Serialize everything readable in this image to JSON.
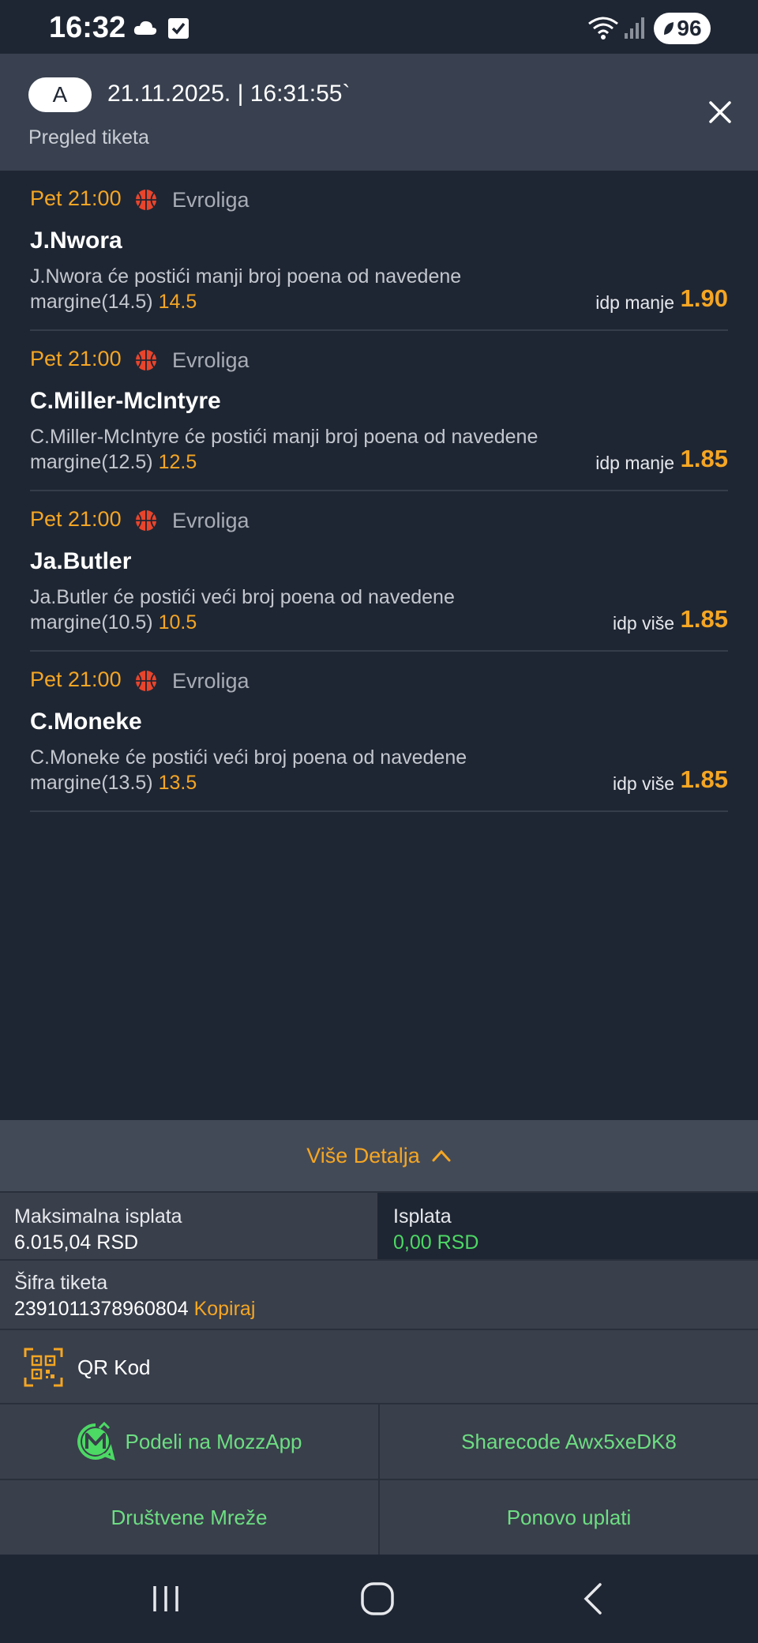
{
  "status_bar": {
    "time": "16:32",
    "battery": "96",
    "icons": [
      "cloud-icon",
      "check-icon",
      "wifi-icon",
      "signal-icon",
      "battery-icon"
    ]
  },
  "header": {
    "avatar": "A",
    "datetime": "21.11.2025. | 16:31:55`",
    "subtitle": "Pregled tiketa",
    "close_icon": "close-icon"
  },
  "bets": [
    {
      "time": "Pet 21:00",
      "league": "Evroliga",
      "player": "J.Nwora",
      "desc_line1": "J.Nwora će postići manji broj poena od navedene",
      "desc_line2": "margine(14.5)",
      "margin": "14.5",
      "type": "idp manje",
      "odds": "1.90"
    },
    {
      "time": "Pet 21:00",
      "league": "Evroliga",
      "player": "C.Miller-McIntyre",
      "desc_line1": "C.Miller-McIntyre će postići manji broj poena od navedene",
      "desc_line2": "margine(12.5)",
      "margin": "12.5",
      "type": "idp manje",
      "odds": "1.85"
    },
    {
      "time": "Pet 21:00",
      "league": "Evroliga",
      "player": "Ja.Butler",
      "desc_line1": "Ja.Butler će postići veći broj poena od navedene",
      "desc_line2": "margine(10.5)",
      "margin": "10.5",
      "type": "idp više",
      "odds": "1.85"
    },
    {
      "time": "Pet 21:00",
      "league": "Evroliga",
      "player": "C.Moneke",
      "desc_line1": "C.Moneke će postići veći broj poena od navedene",
      "desc_line2": "margine(13.5)",
      "margin": "13.5",
      "type": "idp više",
      "odds": "1.85"
    }
  ],
  "details": {
    "more_label": "Više Detalja",
    "max_payout_label": "Maksimalna isplata",
    "max_payout_value": "6.015,04 RSD",
    "payout_label": "Isplata",
    "payout_value": "0,00 RSD",
    "ticket_code_label": "Šifra tiketa",
    "ticket_code": "2391011378960804",
    "copy_label": "Kopiraj",
    "qr_label": "QR Kod"
  },
  "actions": {
    "share_mozz": "Podeli na MozzApp",
    "sharecode": "Sharecode Awx5xeDK8",
    "social": "Društvene Mreže",
    "replay": "Ponovo uplati"
  },
  "colors": {
    "background": "#1f2633",
    "header": "#394150",
    "accent_orange": "#f5a623",
    "accent_green": "#6dde82"
  }
}
